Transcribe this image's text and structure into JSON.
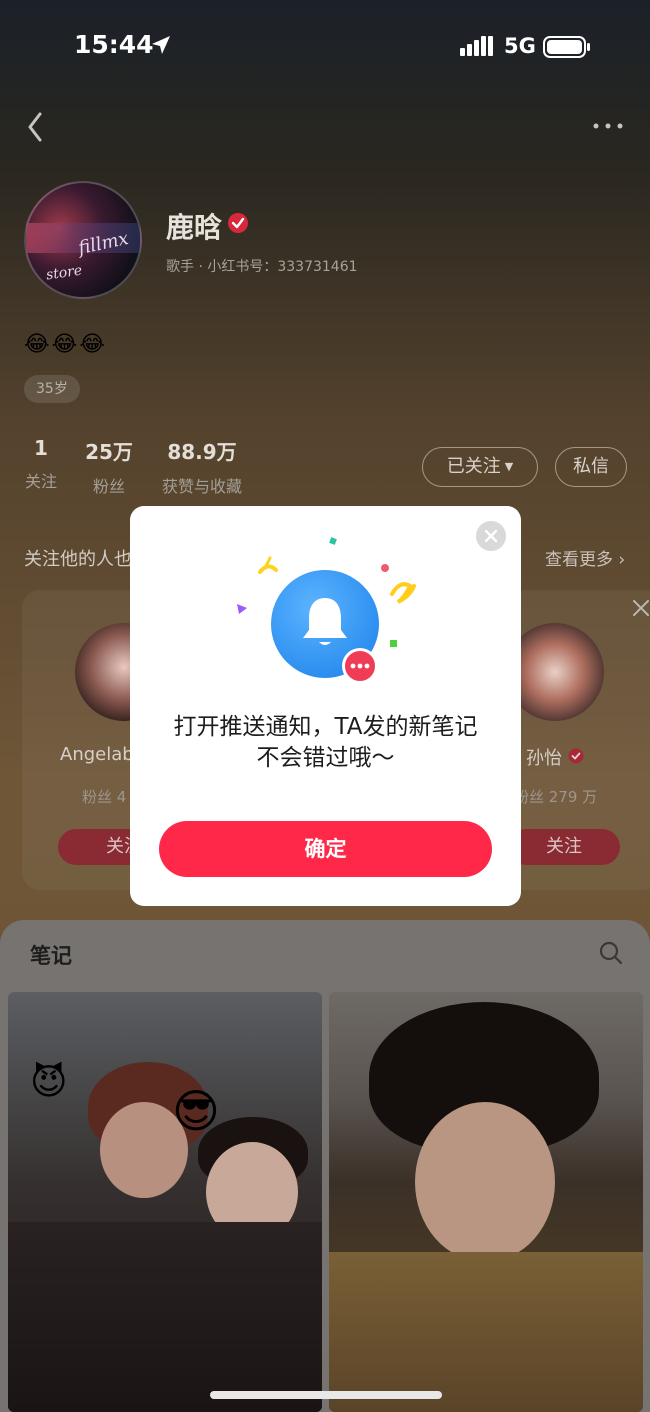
{
  "status_bar": {
    "time": "15:44",
    "network": "5G",
    "icons": [
      "location-arrow-icon",
      "signal-icon",
      "battery-icon"
    ]
  },
  "nav": {
    "icons": [
      "back-icon",
      "more-icon"
    ]
  },
  "profile": {
    "name": "鹿晗",
    "avatar_text": "fillmx",
    "avatar_sub": "store",
    "sub_info": "歌手 · 小红书号：333731461",
    "emojis": "😂😂😂",
    "age_tag": "35岁",
    "stats": [
      {
        "value": "1",
        "label": "关注"
      },
      {
        "value": "25万",
        "label": "粉丝"
      },
      {
        "value": "88.9万",
        "label": "获赞与收藏"
      }
    ],
    "follow_button": "已关注",
    "message_button": "私信"
  },
  "suggested": {
    "title": "关注他的人也",
    "see_more": "查看更多",
    "users": [
      {
        "name": "Angelab",
        "fans": "粉丝 4",
        "follow": "关注"
      },
      {
        "name": "孙怡",
        "fans": "粉丝 279 万",
        "follow": "关注"
      }
    ]
  },
  "notes": {
    "tab_label": "笔记",
    "stickers": [
      "😈",
      "😎"
    ]
  },
  "modal": {
    "message_line1": "打开推送通知，TA发的新笔记",
    "message_line2": "不会错过哦～",
    "confirm_label": "确定"
  },
  "colors": {
    "accent": "#ff2849",
    "bell_blue": "#2d8ff0",
    "badge_red": "#f03c56"
  }
}
